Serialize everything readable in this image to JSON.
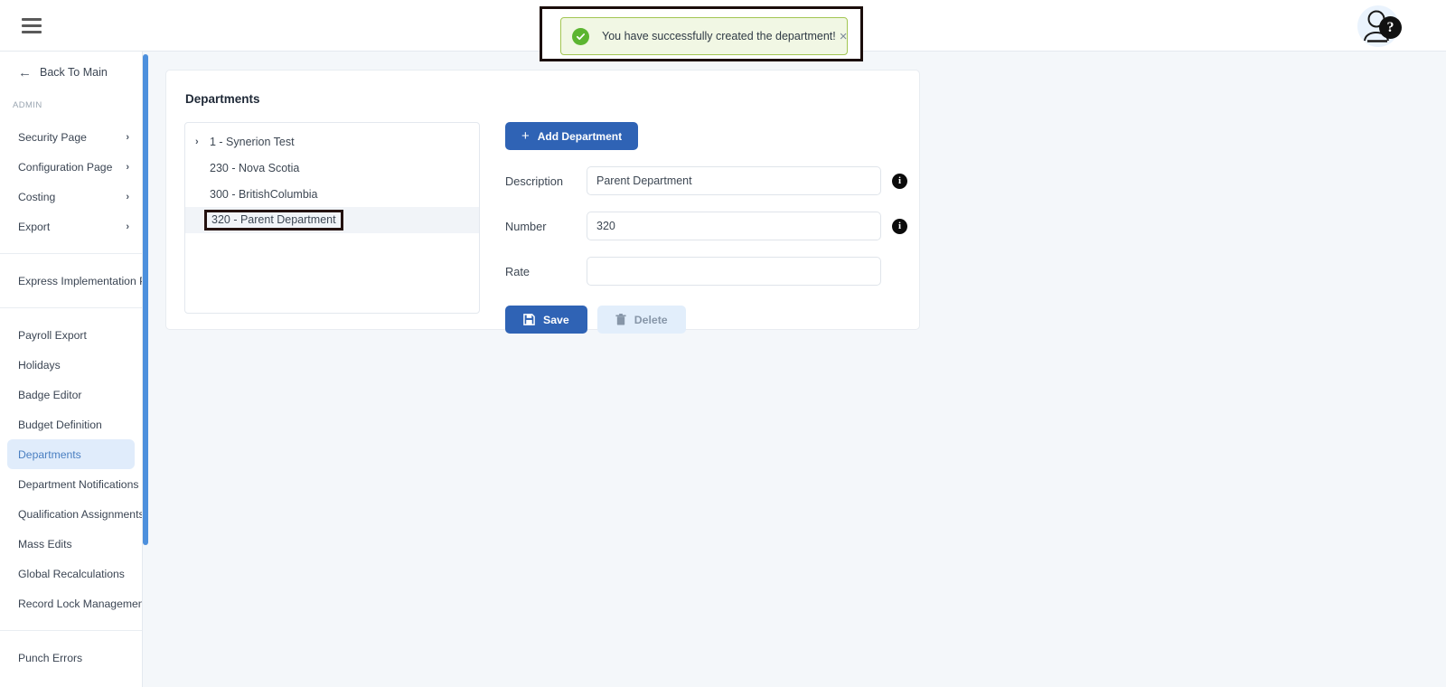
{
  "header": {
    "menu_icon": "hamburger-icon",
    "avatar_icon": "user-avatar-icon",
    "help_badge_label": "?"
  },
  "toast": {
    "message": "You have successfully created the department!",
    "close_label": "×",
    "status_icon": "check-circle-icon",
    "bg_color": "#f1f7e4",
    "border_color": "#a3c653",
    "icon_color": "#5cb531"
  },
  "sidebar": {
    "back_label": "Back To Main",
    "back_icon": "arrow-left-icon",
    "section_label": "ADMIN",
    "expandable_items": [
      {
        "label": "Security Page",
        "chevron": "›"
      },
      {
        "label": "Configuration Page",
        "chevron": "›"
      },
      {
        "label": "Costing",
        "chevron": "›"
      },
      {
        "label": "Export",
        "chevron": "›"
      }
    ],
    "group_two": [
      {
        "label": "Express Implementation P..."
      }
    ],
    "group_three": [
      {
        "label": "Payroll Export",
        "active": false
      },
      {
        "label": "Holidays",
        "active": false
      },
      {
        "label": "Badge Editor",
        "active": false
      },
      {
        "label": "Budget Definition",
        "active": false
      },
      {
        "label": "Departments",
        "active": true
      },
      {
        "label": "Department Notifications",
        "active": false
      },
      {
        "label": "Qualification Assignments",
        "active": false
      },
      {
        "label": "Mass Edits",
        "active": false
      },
      {
        "label": "Global Recalculations",
        "active": false
      },
      {
        "label": "Record Lock Management",
        "active": false
      }
    ],
    "group_four": [
      {
        "label": "Punch Errors"
      }
    ],
    "active_bg_color": "#e0ecfb",
    "active_text_color": "#4a7fc1",
    "scrollbar_color": "#4d90dd"
  },
  "main": {
    "card_title": "Departments",
    "tree": {
      "nodes": [
        {
          "label": "1 - Synerion Test",
          "expandable": true,
          "twisty": "›",
          "selected": false,
          "highlighted": false
        },
        {
          "label": "230 - Nova Scotia",
          "expandable": false,
          "twisty": "",
          "selected": false,
          "highlighted": false
        },
        {
          "label": "300 - BritishColumbia",
          "expandable": false,
          "twisty": "",
          "selected": false,
          "highlighted": false
        },
        {
          "label": "320 - Parent Department",
          "expandable": false,
          "twisty": "",
          "selected": true,
          "highlighted": true
        }
      ]
    },
    "add_button": {
      "label": "Add Department",
      "plus": "+",
      "color": "#2f63b5"
    },
    "fields": [
      {
        "label": "Description",
        "value": "Parent Department",
        "placeholder": "",
        "has_info": true,
        "name": "description"
      },
      {
        "label": "Number",
        "value": "320",
        "placeholder": "",
        "has_info": true,
        "name": "number"
      },
      {
        "label": "Rate",
        "value": "",
        "placeholder": "",
        "has_info": false,
        "name": "rate"
      }
    ],
    "save_button": {
      "label": "Save",
      "icon": "save-disk-icon",
      "color": "#2f63b5"
    },
    "delete_button": {
      "label": "Delete",
      "icon": "trash-icon",
      "color": "#e2eefb",
      "text_color": "#8796a8"
    }
  },
  "theme": {
    "page_bg": "#f4f7fa",
    "panel_bg": "#ffffff",
    "accent": "#2f63b5"
  }
}
